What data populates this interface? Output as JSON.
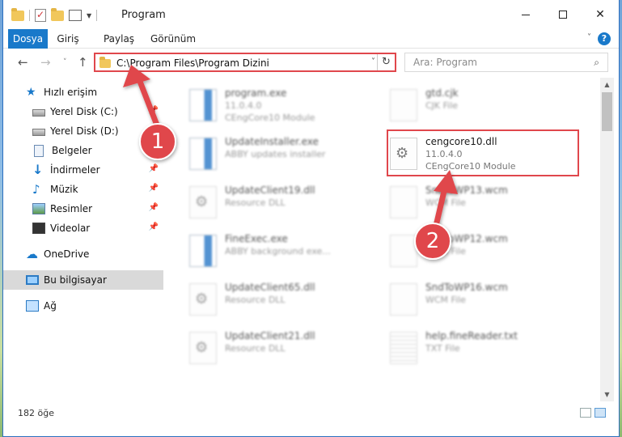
{
  "window": {
    "title": "Program",
    "controls": {
      "minimize_icon": "minimize-icon",
      "maximize_icon": "maximize-icon",
      "close_glyph": "✕"
    }
  },
  "ribbon": {
    "tabs": [
      {
        "label": "Dosya",
        "active": true
      },
      {
        "label": "Giriş"
      },
      {
        "label": "Paylaş"
      },
      {
        "label": "Görünüm"
      }
    ],
    "help_glyph": "?"
  },
  "nav": {
    "back_glyph": "←",
    "forward_glyph": "→",
    "recent_glyph": "˅",
    "up_glyph": "↑",
    "address": "C:\\Program Files\\Program Dizini",
    "refresh_glyph": "↻",
    "search_placeholder": "Ara: Program",
    "search_glyph": "⌕"
  },
  "sidebar": {
    "items": [
      {
        "label": "Hızlı erişim",
        "icon": "star-icon"
      },
      {
        "label": "Yerel Disk (C:)",
        "icon": "disk-icon",
        "pinned": true
      },
      {
        "label": "Yerel Disk (D:)",
        "icon": "disk-icon"
      },
      {
        "label": "Belgeler",
        "icon": "documents-icon"
      },
      {
        "label": "İndirmeler",
        "icon": "download-icon",
        "pinned": true
      },
      {
        "label": "Müzik",
        "icon": "music-icon",
        "pinned": true
      },
      {
        "label": "Resimler",
        "icon": "pictures-icon",
        "pinned": true
      },
      {
        "label": "Videolar",
        "icon": "video-icon",
        "pinned": true
      },
      {
        "label": "OneDrive",
        "icon": "cloud-icon"
      },
      {
        "label": "Bu bilgisayar",
        "icon": "computer-icon",
        "selected": true
      },
      {
        "label": "Ağ",
        "icon": "network-icon"
      }
    ]
  },
  "files": [
    {
      "name": "program.exe",
      "line2": "11.0.4.0",
      "line3": "CEngCore10 Module",
      "icon": "exe-icon",
      "blurred": true
    },
    {
      "name": "gtd.cjk",
      "line2": "CJK File",
      "line3": "",
      "icon": "file-icon",
      "blurred": true
    },
    {
      "name": "UpdateInstaller.exe",
      "line2": "ABBY updates installer",
      "line3": "",
      "icon": "installer-icon",
      "blurred": true
    },
    {
      "name": "cengcore10.dll",
      "line2": "11.0.4.0",
      "line3": "CEngCore10 Module",
      "icon": "dll-gear-icon",
      "blurred": false,
      "highlighted": true
    },
    {
      "name": "UpdateClient19.dll",
      "line2": "Resource DLL",
      "line3": "",
      "icon": "dll-gear-icon",
      "blurred": true
    },
    {
      "name": "SndToWP13.wcm",
      "line2": "WCM File",
      "line3": "",
      "icon": "file-icon",
      "blurred": true
    },
    {
      "name": "FineExec.exe",
      "line2": "ABBY background exe...",
      "line3": "",
      "icon": "installer-icon",
      "blurred": true
    },
    {
      "name": "SndToWP12.wcm",
      "line2": "WCM File",
      "line3": "",
      "icon": "file-icon",
      "blurred": true
    },
    {
      "name": "UpdateClient65.dll",
      "line2": "Resource DLL",
      "line3": "",
      "icon": "dll-gear-icon",
      "blurred": true
    },
    {
      "name": "SndToWP16.wcm",
      "line2": "WCM File",
      "line3": "",
      "icon": "file-icon",
      "blurred": true
    },
    {
      "name": "UpdateClient21.dll",
      "line2": "Resource DLL",
      "line3": "",
      "icon": "dll-gear-icon",
      "blurred": true
    },
    {
      "name": "help.fineReader.txt",
      "line2": "TXT File",
      "line3": "",
      "icon": "text-file-icon",
      "blurred": true
    }
  ],
  "status": {
    "item_count": "182 öğe"
  },
  "annotations": [
    {
      "number": "1",
      "color": "#e0474c"
    },
    {
      "number": "2",
      "color": "#e0474c"
    }
  ]
}
